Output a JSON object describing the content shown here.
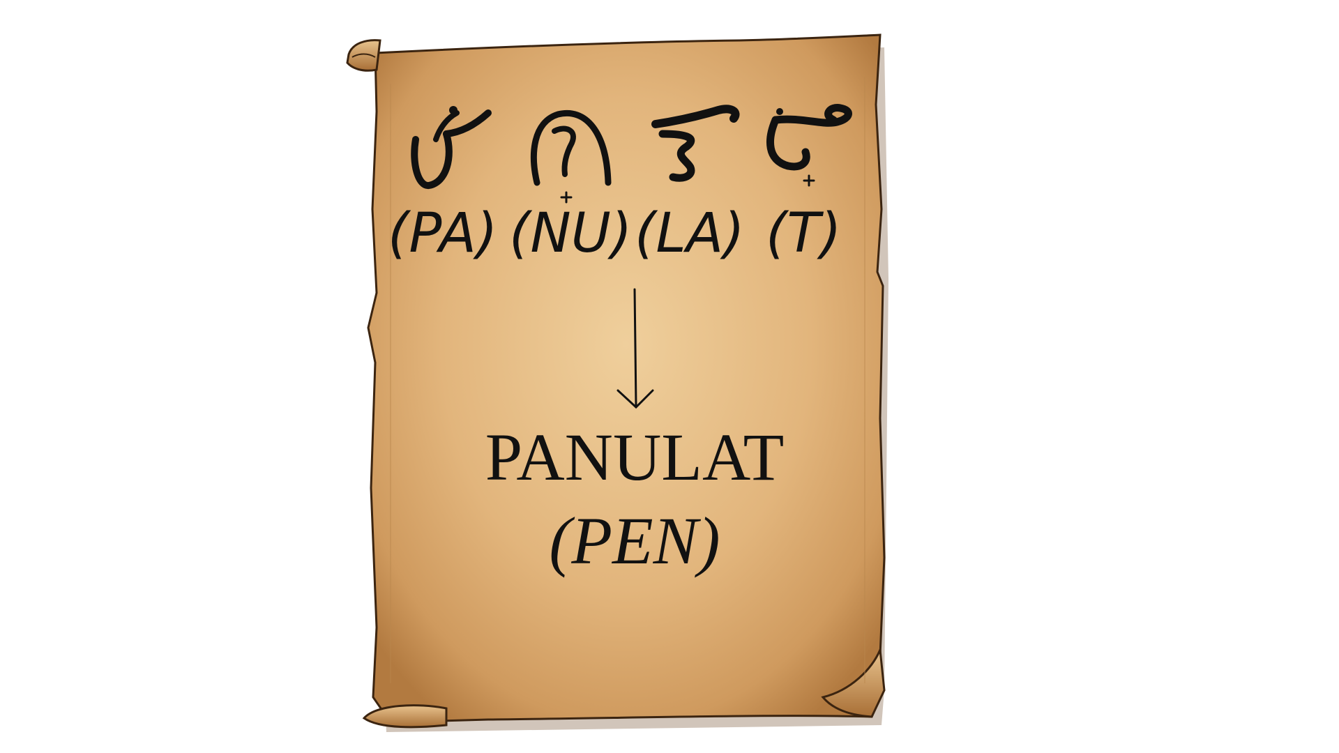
{
  "scroll": {
    "glyph_icons": [
      "baybayin-pa-glyph-icon",
      "baybayin-nu-glyph-icon",
      "baybayin-la-glyph-icon",
      "baybayin-t-glyph-icon"
    ],
    "syllables": [
      "(PA)",
      "(NU)",
      "(LA)",
      "(T)"
    ],
    "word": "PANULAT",
    "translation": "(PEN)"
  },
  "colors": {
    "parchment_light": "#e9c591",
    "parchment_mid": "#d9a96c",
    "parchment_edge": "#a9743c",
    "outline": "#3b2410",
    "ink": "#111111"
  }
}
